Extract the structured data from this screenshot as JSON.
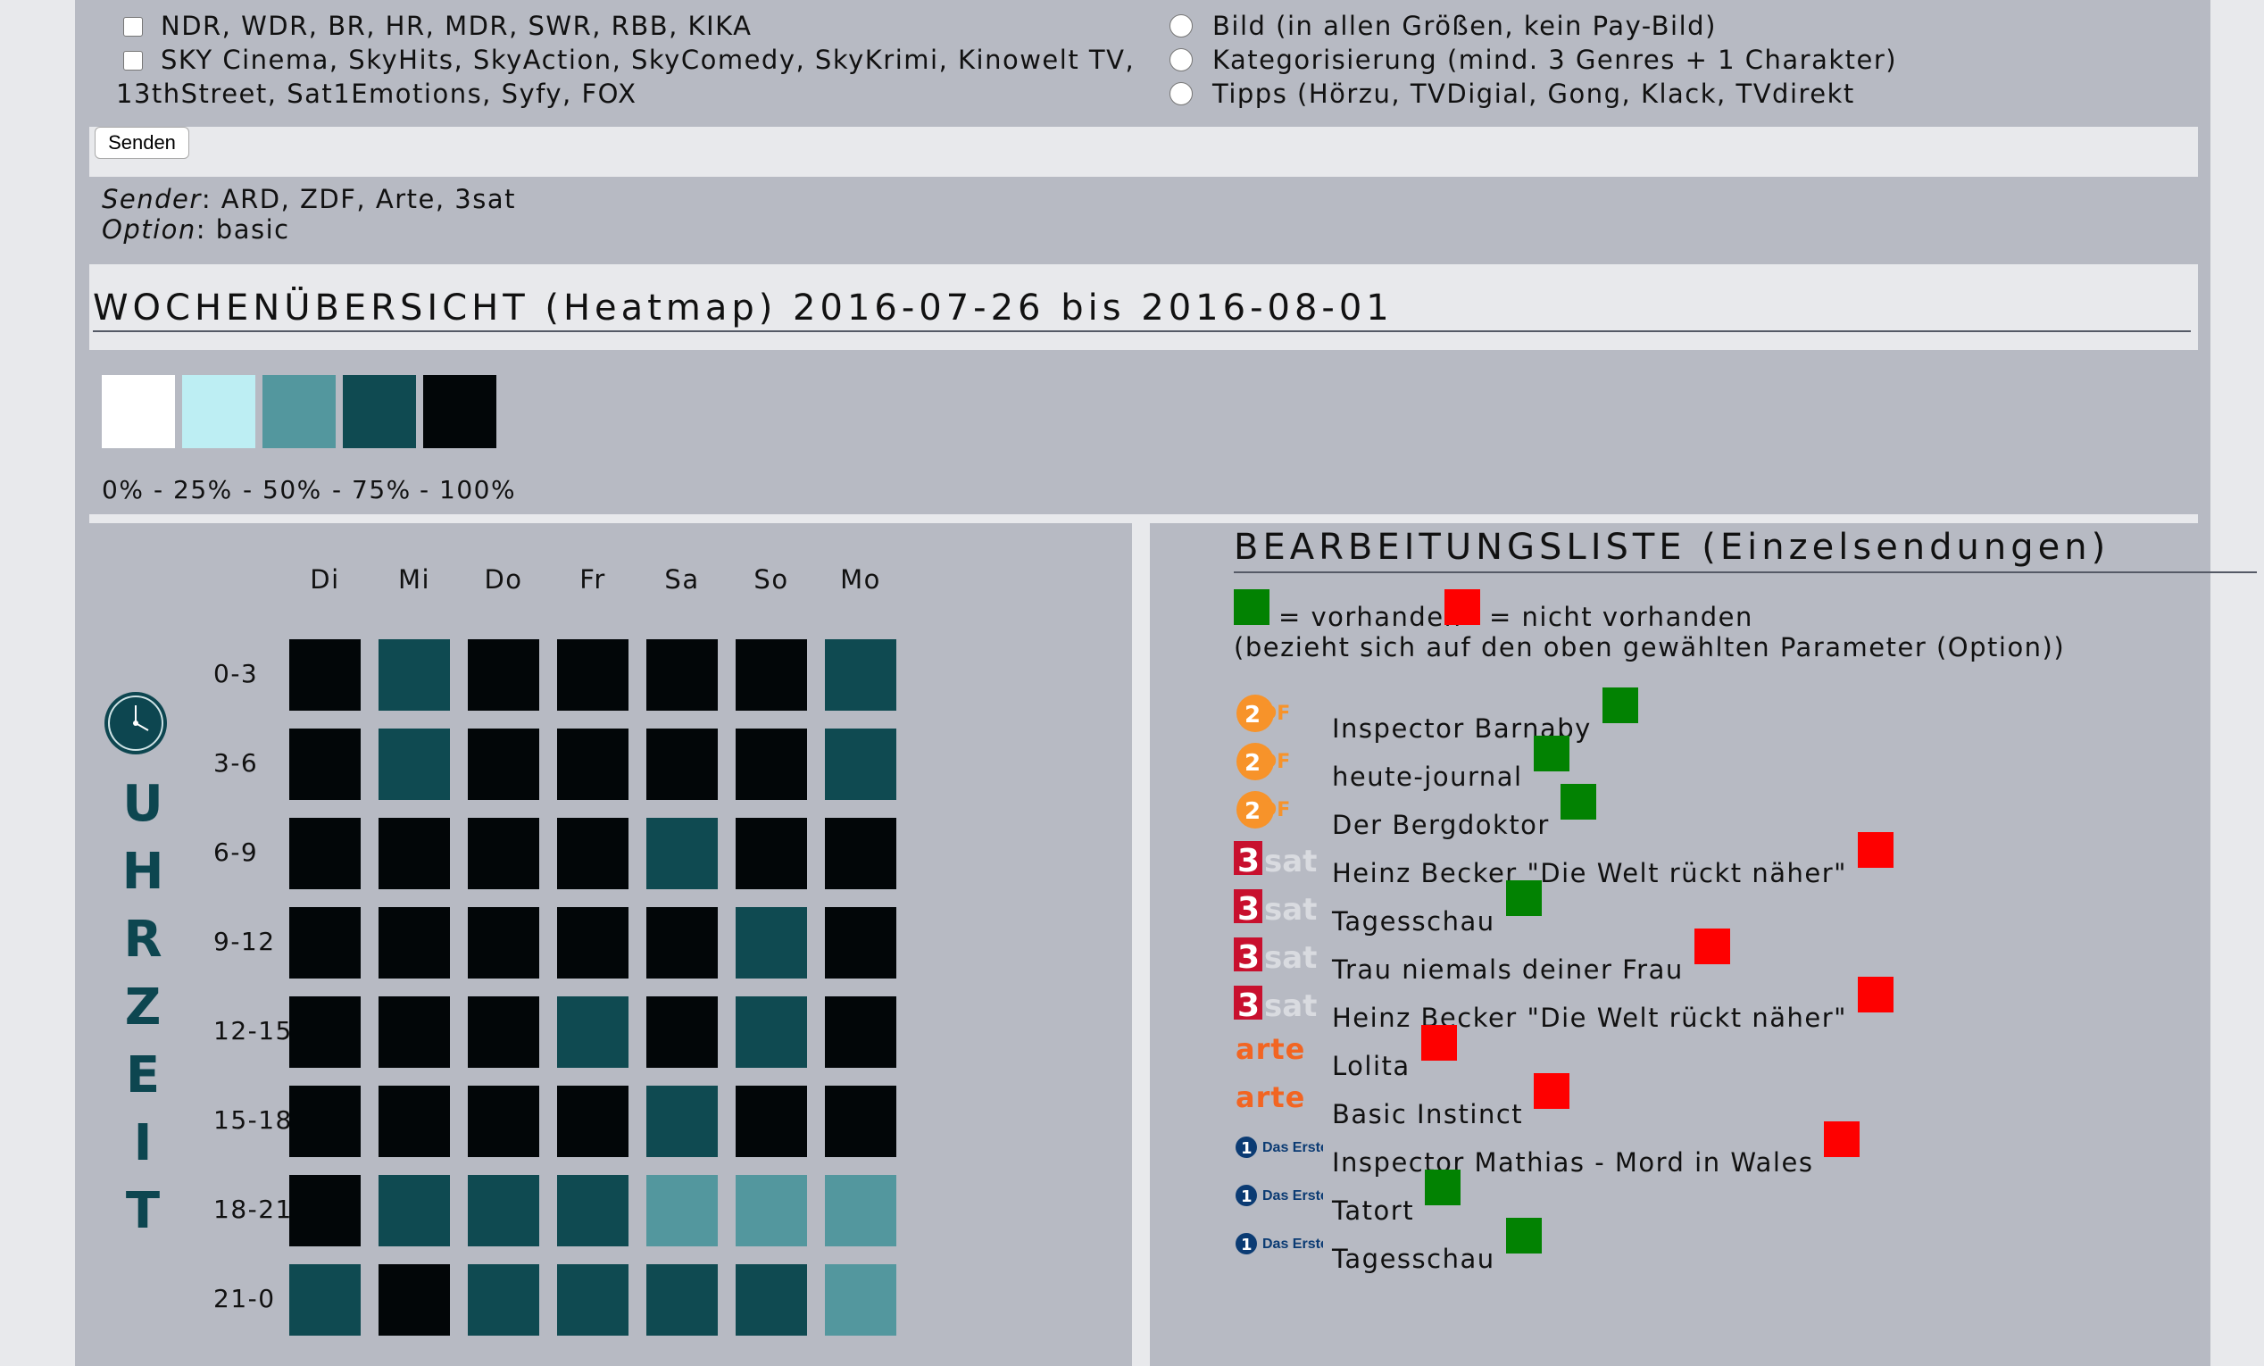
{
  "form": {
    "channel_options": [
      {
        "label": "NDR, WDR, BR, HR, MDR, SWR, RBB, KIKA"
      },
      {
        "label": "SKY Cinema, SkyHits, SkyAction, SkyComedy, SkyKrimi, Kinowelt TV,",
        "label_cont": "13thStreet, Sat1Emotions, Syfy, FOX"
      }
    ],
    "data_options": [
      {
        "label": "Bild (in allen Größen, kein Pay-Bild)"
      },
      {
        "label": "Kategorisierung (mind. 3 Genres + 1 Charakter)"
      },
      {
        "label": "Tipps (Hörzu, TVDigial, Gong, Klack, TVdirekt"
      }
    ],
    "submit_label": "Senden"
  },
  "selection": {
    "sender_label": "Sender",
    "sender_value": ": ARD, ZDF, Arte, 3sat",
    "option_label": "Option",
    "option_value": ": basic"
  },
  "heatmap": {
    "title": "WOCHENÜBERSICHT (Heatmap) 2016-07-26 bis 2016-08-01",
    "legend": {
      "colors": [
        "#ffffff",
        "#bdeef3",
        "#53979e",
        "#0f4a51",
        "#020608"
      ],
      "labels": [
        "0%",
        "- 25%",
        "- 50%",
        "- 75%",
        "- 100%"
      ]
    },
    "days": [
      "Di",
      "Mi",
      "Do",
      "Fr",
      "Sa",
      "So",
      "Mo"
    ],
    "hours": [
      "0-3",
      "3-6",
      "6-9",
      "9-12",
      "12-15",
      "15-18",
      "18-21",
      "21-0"
    ],
    "uhrzeit_letters": [
      "U",
      "H",
      "R",
      "Z",
      "E",
      "I",
      "T"
    ],
    "level_colors": {
      "2": "#53979e",
      "3": "#0f4a51",
      "4": "#020608"
    },
    "levels": [
      [
        4,
        3,
        4,
        4,
        4,
        4,
        3
      ],
      [
        4,
        3,
        4,
        4,
        4,
        4,
        3
      ],
      [
        4,
        4,
        4,
        4,
        3,
        4,
        4
      ],
      [
        4,
        4,
        4,
        4,
        4,
        3,
        4
      ],
      [
        4,
        4,
        4,
        3,
        4,
        3,
        4
      ],
      [
        4,
        4,
        4,
        4,
        3,
        4,
        4
      ],
      [
        4,
        3,
        3,
        3,
        2,
        2,
        2
      ],
      [
        3,
        4,
        3,
        3,
        3,
        3,
        2
      ]
    ]
  },
  "list": {
    "title": "BEARBEITUNGSLISTE (Einzelsendungen)",
    "key_present": "= vorhanden",
    "key_missing": "= nicht vorhanden",
    "key_note": "(bezieht sich auf den oben gewählten Parameter (Option))",
    "status_colors": {
      "present": "#028202",
      "missing": "#fe0000"
    },
    "items": [
      {
        "channel": "zdf",
        "logo_text": "2DF",
        "title": "Inspector Barnaby",
        "status": "present"
      },
      {
        "channel": "zdf",
        "logo_text": "2DF",
        "title": "heute-journal",
        "status": "present"
      },
      {
        "channel": "zdf",
        "logo_text": "2DF",
        "title": "Der Bergdoktor",
        "status": "present"
      },
      {
        "channel": "3sat",
        "logo_text": "3sat",
        "title": "Heinz Becker \"Die Welt rückt näher\"",
        "status": "missing"
      },
      {
        "channel": "3sat",
        "logo_text": "3sat",
        "title": "Tagesschau",
        "status": "present"
      },
      {
        "channel": "3sat",
        "logo_text": "3sat",
        "title": "Trau niemals deiner Frau",
        "status": "missing"
      },
      {
        "channel": "3sat",
        "logo_text": "3sat",
        "title": "Heinz Becker \"Die Welt rückt näher\"",
        "status": "missing"
      },
      {
        "channel": "arte",
        "logo_text": "arte",
        "title": "Lolita",
        "status": "missing"
      },
      {
        "channel": "arte",
        "logo_text": "arte",
        "title": "Basic Instinct",
        "status": "missing"
      },
      {
        "channel": "ard",
        "logo_text": "Das Erste",
        "title": "Inspector Mathias - Mord in Wales",
        "status": "missing"
      },
      {
        "channel": "ard",
        "logo_text": "Das Erste",
        "title": "Tatort",
        "status": "present"
      },
      {
        "channel": "ard",
        "logo_text": "Das Erste",
        "title": "Tagesschau",
        "status": "present"
      }
    ]
  }
}
